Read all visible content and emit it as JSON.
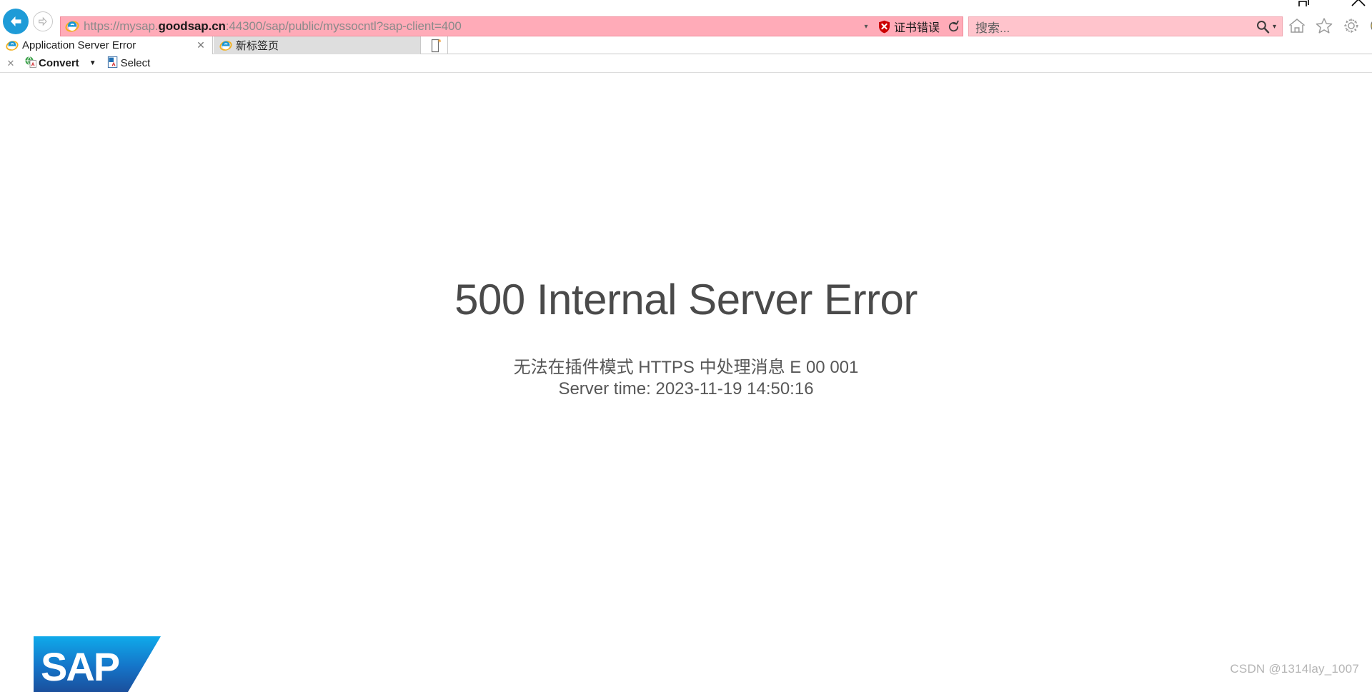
{
  "window": {
    "restore_label": "restore-window",
    "close_label": "close-window"
  },
  "navigation": {
    "back_label": "Back",
    "forward_label": "Forward",
    "refresh_label": "Refresh"
  },
  "address_bar": {
    "protocol": "https://",
    "host_prefix": "mysap.",
    "host_strong": "goodsap.cn",
    "rest": ":44300/sap/public/myssocntl?sap-client=400",
    "full_url": "https://mysap.goodsap.cn:44300/sap/public/myssocntl?sap-client=400",
    "dropdown_caret": "▾",
    "cert_error_label": "证书错误",
    "refresh_glyph": "↻"
  },
  "search": {
    "placeholder": "搜索...",
    "caret": "▾"
  },
  "toolbar_icons": [
    {
      "name": "home-icon",
      "title": "主页"
    },
    {
      "name": "favorites-star-icon",
      "title": "收藏夹"
    },
    {
      "name": "settings-gear-icon",
      "title": "工具"
    },
    {
      "name": "smiley-feedback-icon",
      "title": "反馈"
    }
  ],
  "tabs": [
    {
      "label": "Application Server Error",
      "active": true,
      "close_glyph": "✕"
    },
    {
      "label": "新标签页",
      "active": false,
      "close_glyph": ""
    }
  ],
  "new_tab": {
    "label": "新建标签页"
  },
  "command_bar": {
    "close_glyph": "✕",
    "convert_label": "Convert",
    "caret_glyph": "▼",
    "select_label": "Select"
  },
  "page_content": {
    "error_title": "500 Internal Server Error",
    "error_message": "无法在插件模式 HTTPS 中处理消息 E 00 001",
    "server_time": "Server time: 2023-11-19 14:50:16",
    "brand_logo_text": "SAP"
  },
  "watermark": {
    "text": "CSDN @1314lay_1007"
  },
  "colors": {
    "address_bar_pink": "#ffabb8",
    "search_box_pink": "#ffc4cc",
    "back_button_blue": "#1e9bd7",
    "cert_error_red": "#cc0000",
    "error_title_grey": "#4a4a4a",
    "tab_inactive_grey": "#dedede",
    "sap_blue_light": "#0faaea",
    "sap_blue_dark": "#1a4f9c"
  }
}
